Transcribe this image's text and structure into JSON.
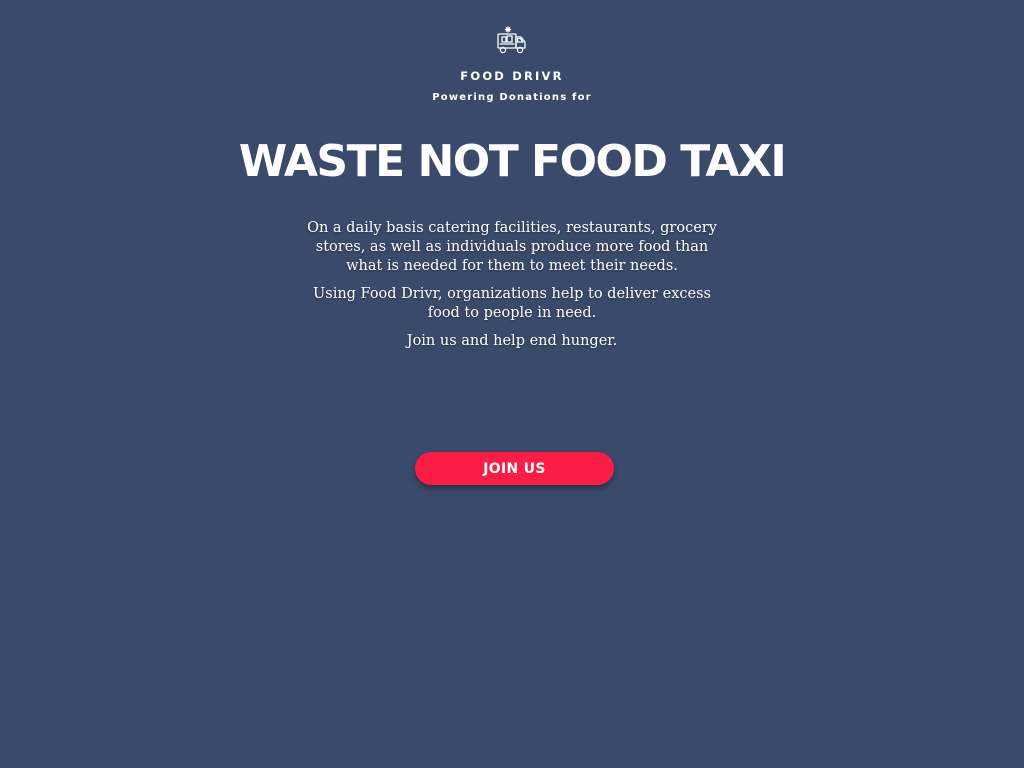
{
  "header": {
    "logo_icon": "food-truck-icon",
    "brand": "FOOD DRIVR",
    "tagline": "Powering Donations for"
  },
  "hero": {
    "title": "WASTE NOT FOOD TAXI",
    "paragraphs": [
      "On a daily basis catering facilities, restaurants, grocery stores, as well as individuals produce more food than what is needed for them to meet their needs.",
      "Using Food Drivr, organizations help to deliver excess food to people in need.",
      "Join us and help end hunger."
    ]
  },
  "cta": {
    "join_label": "JOIN US"
  },
  "colors": {
    "background": "#3a4a6b",
    "accent": "#fb1d45",
    "text": "#ffffff"
  }
}
